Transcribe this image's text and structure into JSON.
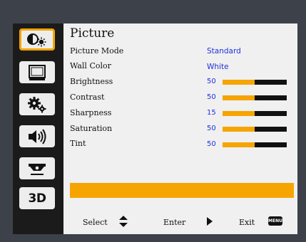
{
  "menu": {
    "title": "Picture",
    "items": [
      {
        "label": "Picture Mode",
        "type": "text",
        "value": "Standard"
      },
      {
        "label": "Wall Color",
        "type": "text",
        "value": "White"
      },
      {
        "label": "Brightness",
        "type": "slider",
        "value": "50",
        "level": 0.5
      },
      {
        "label": "Contrast",
        "type": "slider",
        "value": "50",
        "level": 0.5
      },
      {
        "label": "Sharpness",
        "type": "slider",
        "value": "15",
        "level": 0.5
      },
      {
        "label": "Saturation",
        "type": "slider",
        "value": "50",
        "level": 0.5
      },
      {
        "label": "Tint",
        "type": "slider",
        "value": "50",
        "level": 0.5
      }
    ]
  },
  "sidebar": {
    "items": [
      {
        "icon": "picture-icon",
        "active": true
      },
      {
        "icon": "display-icon",
        "active": false
      },
      {
        "icon": "settings-gears-icon",
        "active": false
      },
      {
        "icon": "volume-icon",
        "active": false
      },
      {
        "icon": "projector-icon",
        "active": false
      },
      {
        "icon": "3d-icon",
        "label": "3D",
        "active": false
      }
    ]
  },
  "footer": {
    "select_label": "Select",
    "enter_label": "Enter",
    "exit_label": "Exit",
    "menu_key_label": "MENU"
  },
  "colors": {
    "accent": "#f5a400",
    "value_text": "#2030d8",
    "panel_bg": "#f0f0f0",
    "sidebar_bg": "#1b1b1b"
  }
}
